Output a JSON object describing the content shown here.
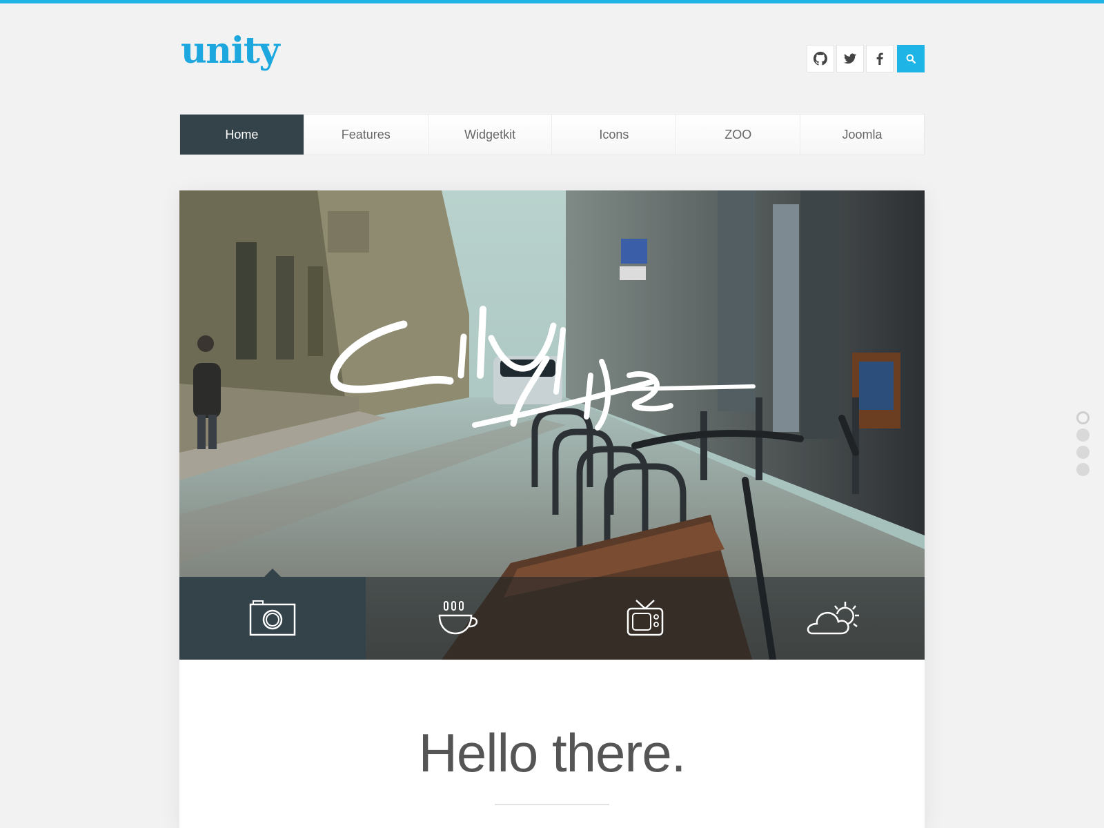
{
  "brand": {
    "logo_text": "unity",
    "accent_color": "#1fb4e6"
  },
  "social": [
    {
      "name": "github-icon",
      "label": "GitHub"
    },
    {
      "name": "twitter-icon",
      "label": "Twitter"
    },
    {
      "name": "facebook-icon",
      "label": "Facebook"
    },
    {
      "name": "search-icon",
      "label": "Search"
    }
  ],
  "nav": {
    "items": [
      {
        "label": "Home",
        "active": true
      },
      {
        "label": "Features"
      },
      {
        "label": "Widgetkit"
      },
      {
        "label": "Icons"
      },
      {
        "label": "ZOO"
      },
      {
        "label": "Joomla"
      }
    ]
  },
  "slideshow": {
    "slide_title": "City Life",
    "tabs": [
      {
        "icon": "camera-icon",
        "active": true
      },
      {
        "icon": "coffee-cup-icon"
      },
      {
        "icon": "tv-icon"
      },
      {
        "icon": "weather-icon"
      }
    ],
    "dots": {
      "count": 4,
      "active_index": 0
    }
  },
  "content": {
    "heading": "Hello there."
  }
}
